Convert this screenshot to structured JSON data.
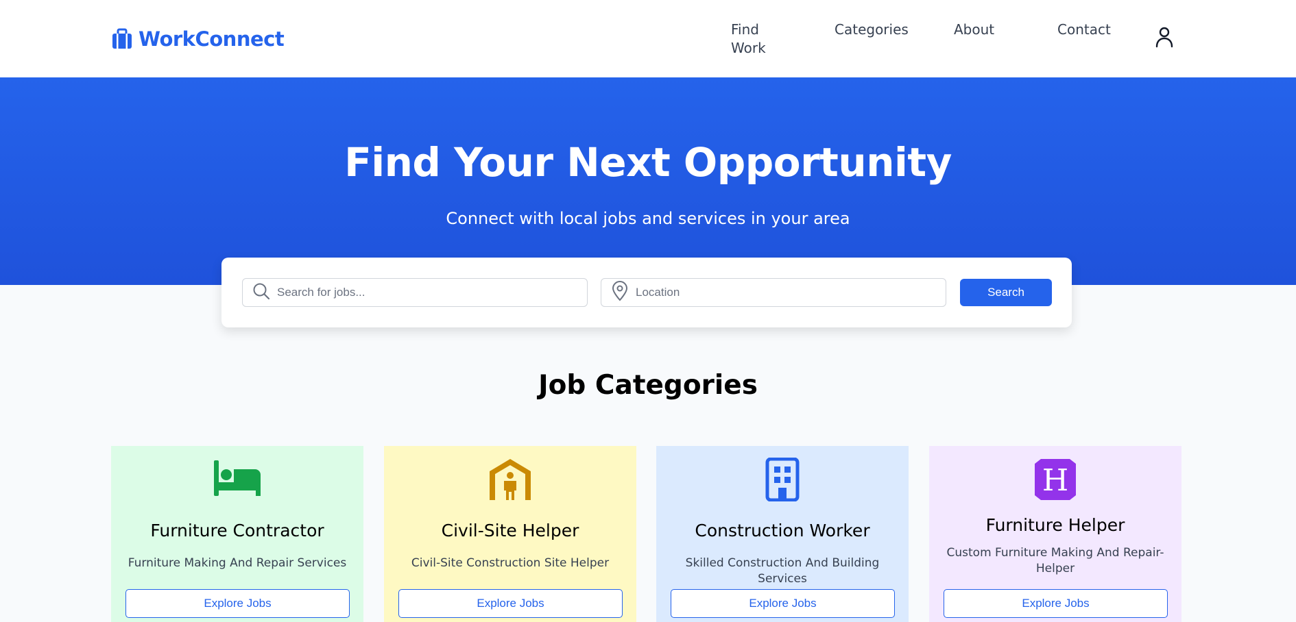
{
  "brand": {
    "name": "WorkConnect",
    "color": "#2563eb",
    "icon": "briefcase-icon"
  },
  "nav": {
    "find_work": "Find Work",
    "categories": "Categories",
    "about": "About",
    "contact": "Contact",
    "user_icon": "user-icon"
  },
  "hero": {
    "title": "Find Your Next Opportunity",
    "subtitle": "Connect with local jobs and services in your area"
  },
  "search": {
    "query_placeholder": "Search for jobs...",
    "location_placeholder": "Location",
    "button": "Search"
  },
  "section": {
    "title": "Job Categories"
  },
  "categories": [
    {
      "title": "Furniture Contractor",
      "description": "Furniture Making And Repair Services",
      "button": "Explore Jobs",
      "icon": "bed-icon",
      "icon_color": "#16a34a",
      "background": "#dcfce7"
    },
    {
      "title": "Civil-Site Helper",
      "description": "Civil-Site Construction Site Helper",
      "button": "Explore Jobs",
      "icon": "house-person-icon",
      "icon_color": "#ca8a04",
      "background": "#fef9c3"
    },
    {
      "title": "Construction Worker",
      "description": "Skilled Construction And Building Services",
      "button": "Explore Jobs",
      "icon": "building-icon",
      "icon_color": "#2563eb",
      "background": "#dbeafe"
    },
    {
      "title": "Furniture Helper",
      "description": "Custom Furniture Making And Repair-Helper",
      "button": "Explore Jobs",
      "icon": "h-square-icon",
      "icon_color": "#9333ea",
      "background": "#f3e8ff"
    }
  ]
}
